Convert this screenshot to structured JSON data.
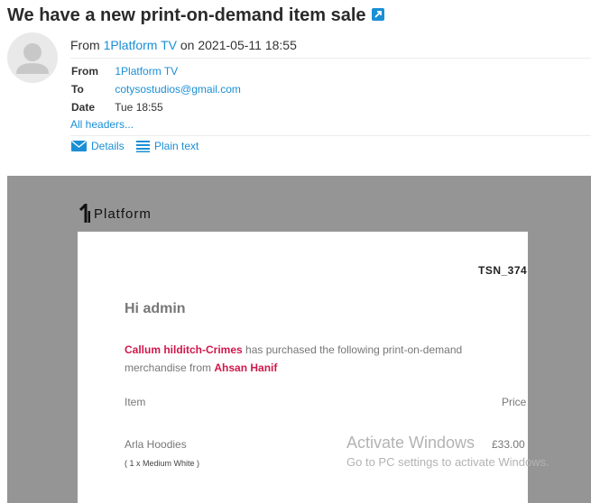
{
  "email": {
    "subject": "We have a new print-on-demand item sale",
    "from_prefix": "From",
    "from_name": "1Platform TV",
    "from_on": "on",
    "datetime": "2021-05-11 18:55",
    "headers": {
      "from_key": "From",
      "from_value": "1Platform TV",
      "to_key": "To",
      "to_value": "cotysostudios@gmail.com",
      "date_key": "Date",
      "date_value": "Tue 18:55"
    },
    "all_headers_label": "All headers...",
    "details_label": "Details",
    "plain_text_label": "Plain text"
  },
  "message": {
    "brand_text": "Platform",
    "reference": "TSN_374",
    "greeting": "Hi admin",
    "buyer": "Callum hilditch-Crimes",
    "text_mid": " has purchased the following print-on-demand merchandise from ",
    "seller": "Ahsan Hanif",
    "col_item": "Item",
    "col_price": "Price",
    "product_name": "Arla Hoodies",
    "product_options": "( 1 x Medium White )",
    "product_price": "£33.00"
  },
  "watermark": {
    "line1": "Activate Windows",
    "line2": "Go to PC settings to activate Windows."
  },
  "colors": {
    "link": "#1a8fd6",
    "highlight": "#d0184b",
    "backdrop": "#959595"
  }
}
